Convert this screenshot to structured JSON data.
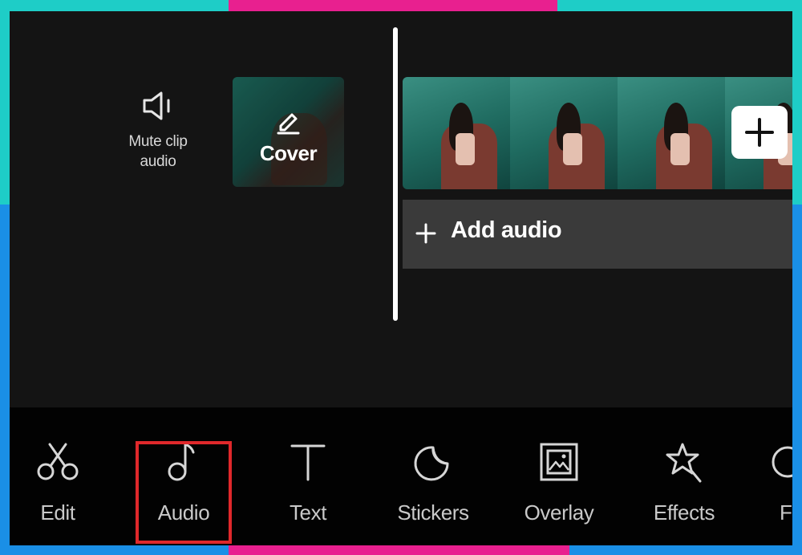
{
  "timeline": {
    "mute": {
      "label": "Mute clip\naudio",
      "icon": "speaker-icon"
    },
    "cover": {
      "label": "Cover",
      "icon": "pencil-icon"
    },
    "add_audio_label": "Add audio",
    "add_clip_icon": "plus-icon"
  },
  "toolbar": {
    "items": [
      {
        "label": "Edit",
        "icon": "scissors-icon"
      },
      {
        "label": "Audio",
        "icon": "music-note-icon",
        "highlighted": true
      },
      {
        "label": "Text",
        "icon": "text-icon"
      },
      {
        "label": "Stickers",
        "icon": "sticker-icon"
      },
      {
        "label": "Overlay",
        "icon": "overlay-icon"
      },
      {
        "label": "Effects",
        "icon": "effects-star-icon"
      },
      {
        "label": "Fi",
        "icon": "filter-icon"
      }
    ]
  },
  "colors": {
    "highlight": "#e0282b",
    "frame_teal": "#1ecdc7",
    "frame_pink": "#e8208f",
    "frame_blue": "#1a8fe6"
  }
}
